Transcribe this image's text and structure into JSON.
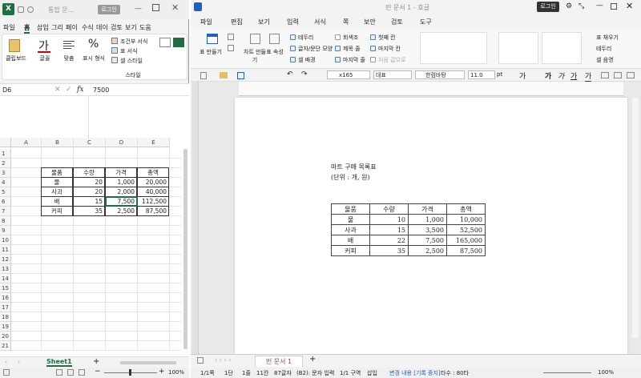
{
  "excel": {
    "app_icon": "X",
    "filename": "통합 문...",
    "login": "로그인",
    "menu": [
      "파일",
      "홈",
      "삽입",
      "그리",
      "페이",
      "수식",
      "데이",
      "검토",
      "보기",
      "도움"
    ],
    "ribbon": {
      "clipboard": "클립보드",
      "font": "글꼴",
      "align": "맞춤",
      "number": "표시 형식",
      "percent": "%",
      "cond_format": "조건부 서식",
      "table_format": "표 서식",
      "cell_style": "셀 스타일",
      "style_group": "스타일"
    },
    "namebox": "D6",
    "fx": "fx",
    "formula": "7500",
    "columns": [
      "A",
      "B",
      "C",
      "D",
      "E"
    ],
    "rows": [
      "1",
      "2",
      "3",
      "4",
      "5",
      "6",
      "7",
      "8",
      "9",
      "10",
      "11",
      "12",
      "13",
      "14",
      "15",
      "16",
      "17",
      "18",
      "19",
      "20",
      "21"
    ],
    "table": {
      "headers": [
        "물품",
        "수량",
        "가격",
        "총액"
      ],
      "rows": [
        [
          "물",
          "20",
          "1,000",
          "20,000"
        ],
        [
          "사과",
          "20",
          "2,000",
          "40,000"
        ],
        [
          "배",
          "15",
          "7,500",
          "112,500"
        ],
        [
          "커피",
          "35",
          "2,500",
          "87,500"
        ]
      ]
    },
    "sheet_tab": "Sheet1",
    "zoom": "100%"
  },
  "hwp": {
    "title": "빈 문서 1 - 호글",
    "login": "로그인",
    "menu": [
      "파일",
      "편집",
      "보기",
      "입력",
      "서식",
      "쪽",
      "보안",
      "검토",
      "도구"
    ],
    "ribbon": {
      "table_create": "표 만들기",
      "chart_create": "차트 만들기",
      "table_props": "표 속성",
      "opts_col1": [
        "테두리",
        "글자/문단 모양",
        "셀 배경"
      ],
      "opts_col2": [
        "회색조",
        "제목 줄",
        "마지막 줄"
      ],
      "opts_col3": [
        "첫째 칸",
        "마지막 칸",
        "처음 값으로"
      ],
      "right": [
        "표 채우기",
        "테두리",
        "셀 음영"
      ]
    },
    "toolbar": {
      "style_box": "x165",
      "style_name": "대표",
      "font": "한컴바탕",
      "size": "11.0",
      "unit": "pt"
    },
    "doc": {
      "line1": "마트 구매 목록표",
      "line2": "(단위 : 개, 원)",
      "headers": [
        "물품",
        "수량",
        "가격",
        "총액"
      ],
      "rows": [
        [
          "물",
          "10",
          "1,000",
          "10,000"
        ],
        [
          "사과",
          "15",
          "3,500",
          "52,500"
        ],
        [
          "배",
          "22",
          "7,500",
          "165,000"
        ],
        [
          "커피",
          "35",
          "2,500",
          "87,500"
        ]
      ]
    },
    "doc_tab": "빈 문서 1",
    "status": [
      "1/1쪽",
      "1단",
      "1줄",
      "11칸",
      "87글자",
      "(B2): 문자 입력",
      "1/1 구역",
      "삽입",
      "변경 내용 [기록 중지]",
      "타수 : 80타"
    ],
    "zoom": "100%"
  },
  "colors": {
    "excel_green": "#1d6f42",
    "hwp_blue": "#1f5fbf",
    "doc_tab_red": "#c0392b"
  }
}
